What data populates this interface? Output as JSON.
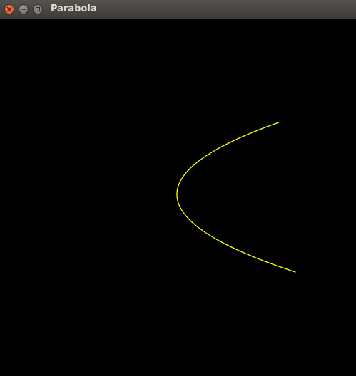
{
  "window": {
    "title": "Parabola"
  },
  "colors": {
    "background": "#000000",
    "curve": "#ffff00",
    "titlebar": "#3c3b37",
    "close_button": "#e0501e"
  },
  "icons": {
    "close": "close-icon",
    "minimize": "minimize-icon",
    "maximize": "maximize-icon"
  },
  "curve": {
    "type": "sideways parabola opening right"
  }
}
